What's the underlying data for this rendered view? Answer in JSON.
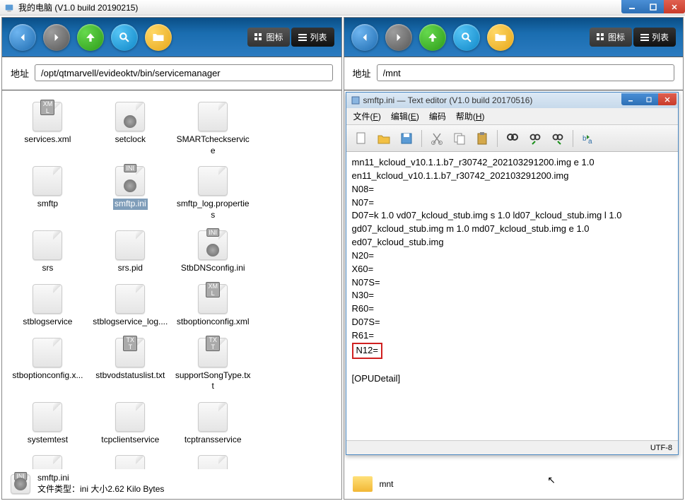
{
  "window": {
    "title": "我的电脑 (V1.0 build 20190215)"
  },
  "toolbar": {
    "view_icons": "图标",
    "view_list": "列表"
  },
  "left": {
    "addr_label": "地址",
    "address": "/opt/qtmarvell/evideoktv/bin/servicemanager",
    "files": [
      {
        "name": "services.xml",
        "type": "xml"
      },
      {
        "name": "setclock",
        "type": "gear"
      },
      {
        "name": "SMARTcheckservice",
        "type": "file"
      },
      {
        "name": "",
        "type": "hidden"
      },
      {
        "name": "smftp",
        "type": "file"
      },
      {
        "name": "smftp.ini",
        "type": "ini",
        "selected": true
      },
      {
        "name": "smftp_log.properties",
        "type": "file"
      },
      {
        "name": "",
        "type": "hidden"
      },
      {
        "name": "srs",
        "type": "file"
      },
      {
        "name": "srs.pid",
        "type": "file"
      },
      {
        "name": "StbDNSconfig.ini",
        "type": "ini"
      },
      {
        "name": "",
        "type": "hidden"
      },
      {
        "name": "stblogservice",
        "type": "file"
      },
      {
        "name": "stblogservice_log....",
        "type": "file"
      },
      {
        "name": "stboptionconfig.xml",
        "type": "xml"
      },
      {
        "name": "",
        "type": "hidden"
      },
      {
        "name": "stboptionconfig.x...",
        "type": "file"
      },
      {
        "name": "stbvodstatuslist.txt",
        "type": "txt"
      },
      {
        "name": "supportSongType.txt",
        "type": "txt"
      },
      {
        "name": "",
        "type": "hidden"
      },
      {
        "name": "systemtest",
        "type": "file"
      },
      {
        "name": "tcpclientservice",
        "type": "file"
      },
      {
        "name": "tcptransservice",
        "type": "file"
      },
      {
        "name": "",
        "type": "hidden"
      },
      {
        "name": "",
        "type": "file"
      },
      {
        "name": "",
        "type": "file"
      },
      {
        "name": "",
        "type": "file"
      }
    ],
    "status": {
      "filename": "smftp.ini",
      "info": "文件类型：ini  大小2.62  Kilo Bytes"
    }
  },
  "right": {
    "addr_label": "地址",
    "address": "/mnt",
    "status_name": "mnt"
  },
  "editor": {
    "title": "smftp.ini — Text editor (V1.0 build 20170516)",
    "menu": {
      "file": "文件(F)",
      "edit": "编辑(E)",
      "encoding": "编码",
      "help": "帮助(H)"
    },
    "lines": [
      "mn11_kcloud_v10.1.1.b7_r30742_202103291200.img e 1.0",
      "en11_kcloud_v10.1.1.b7_r30742_202103291200.img",
      "N08=",
      "N07=",
      "D07=k 1.0 vd07_kcloud_stub.img s 1.0 ld07_kcloud_stub.img l 1.0",
      "gd07_kcloud_stub.img m 1.0 md07_kcloud_stub.img e 1.0",
      "ed07_kcloud_stub.img",
      "N20=",
      "X60=",
      "N07S=",
      "N30=",
      "R60=",
      "D07S=",
      "R61="
    ],
    "highlighted": "N12=",
    "after": [
      "",
      "[OPUDetail]"
    ],
    "encoding": "UTF-8"
  }
}
